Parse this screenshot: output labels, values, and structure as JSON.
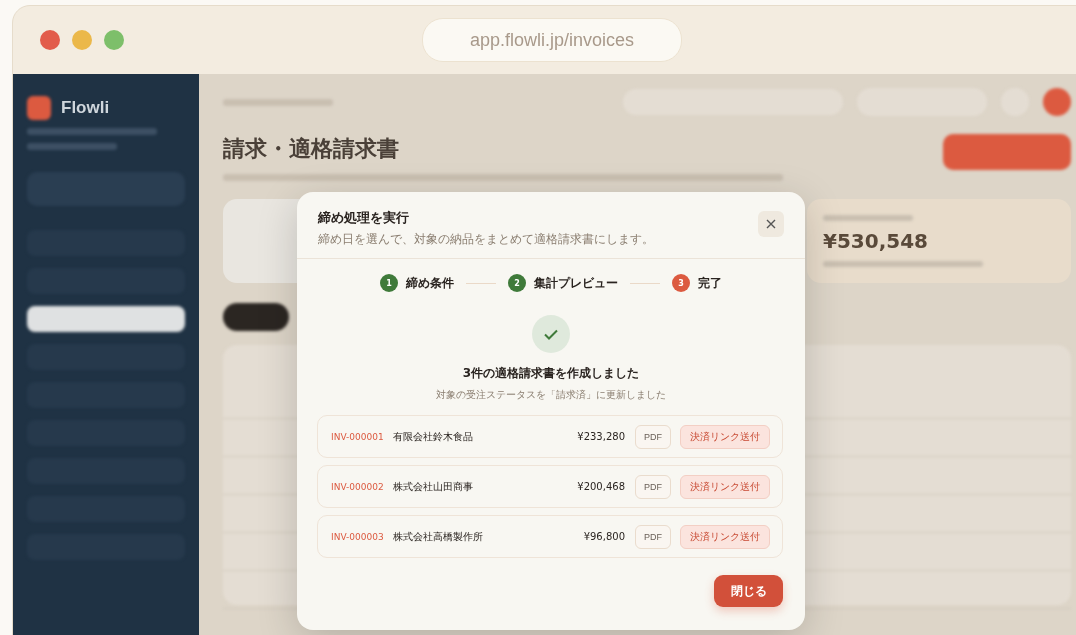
{
  "browser": {
    "url": "app.flowli.jp/invoices"
  },
  "sidebar": {
    "brand": "Flowli"
  },
  "page": {
    "title": "請求・適格請求書",
    "summary_amount": "¥530,548"
  },
  "modal": {
    "title": "締め処理を実行",
    "subtitle": "締め日を選んで、対象の納品をまとめて適格請求書にします。",
    "steps": [
      {
        "number": "1",
        "label": "締め条件",
        "selected": false
      },
      {
        "number": "2",
        "label": "集計プレビュー",
        "selected": false
      },
      {
        "number": "3",
        "label": "完了",
        "selected": true
      }
    ],
    "result_title": "3件の適格請求書を作成しました",
    "result_subtitle": "対象の受注ステータスを「請求済」に更新しました",
    "invoices": [
      {
        "id": "INV-000001",
        "customer": "有限会社鈴木食品",
        "amount": "¥233,280",
        "pdf": "PDF",
        "action": "決済リンク送付"
      },
      {
        "id": "INV-000002",
        "customer": "株式会社山田商事",
        "amount": "¥200,468",
        "pdf": "PDF",
        "action": "決済リンク送付"
      },
      {
        "id": "INV-000003",
        "customer": "株式会社高橋製作所",
        "amount": "¥96,800",
        "pdf": "PDF",
        "action": "決済リンク送付"
      }
    ],
    "close_button": "閉じる"
  }
}
